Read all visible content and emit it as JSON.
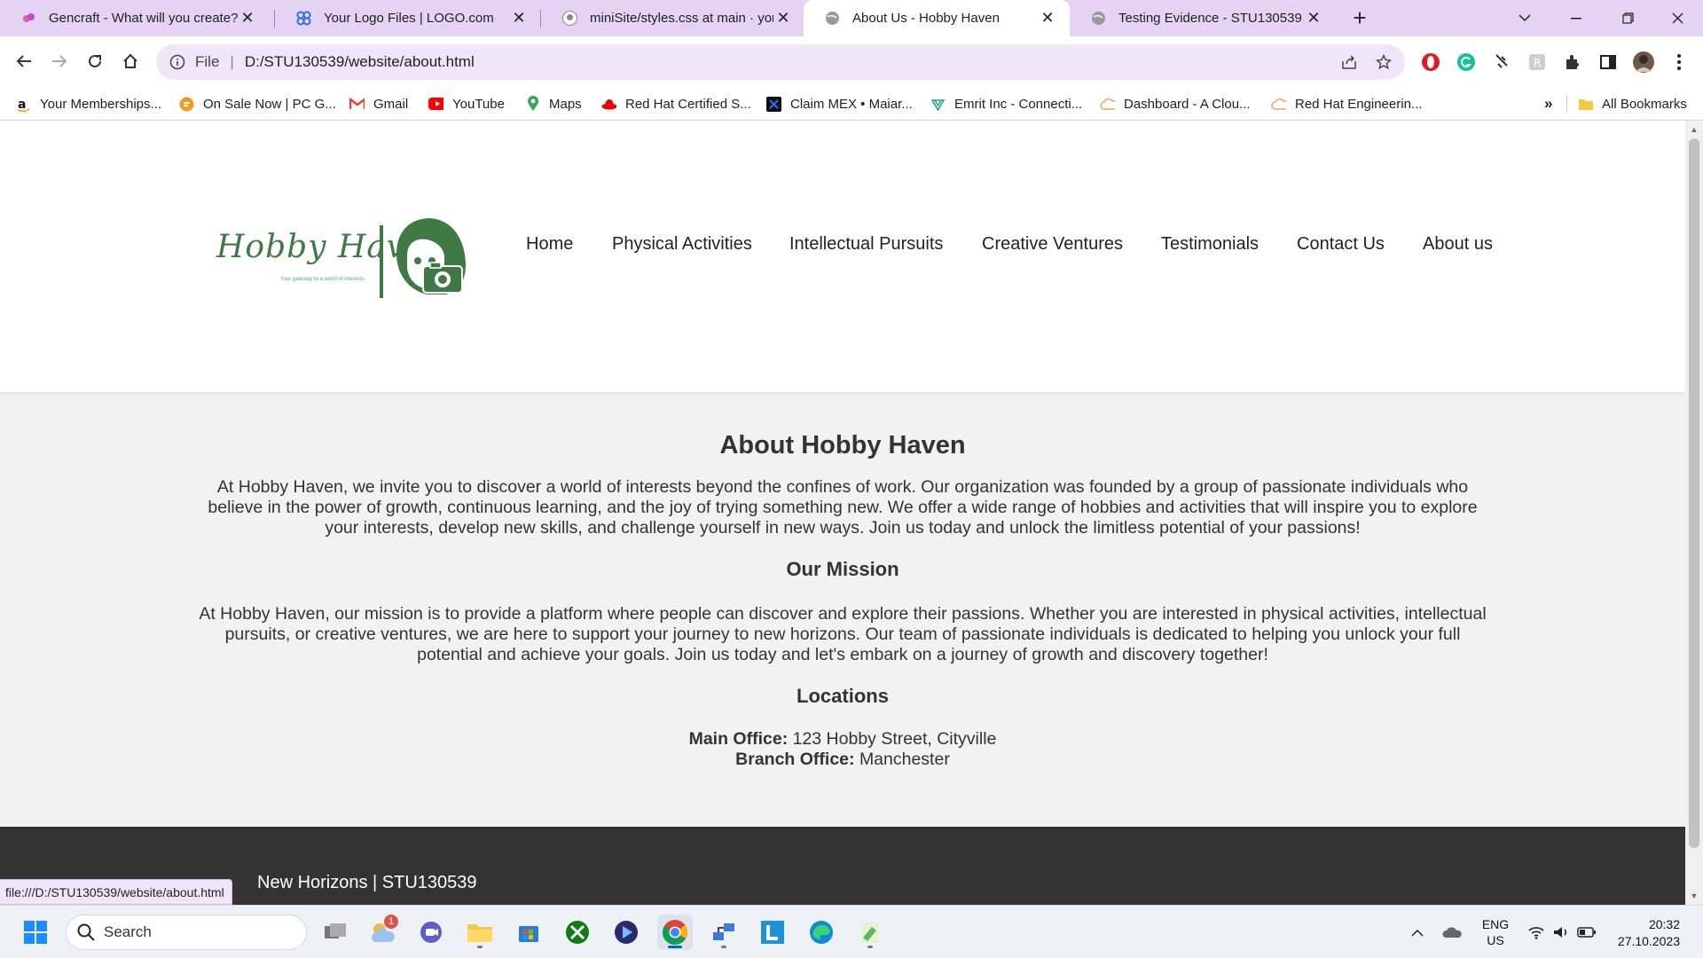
{
  "browser": {
    "tabs": [
      {
        "title": "Gencraft - What will you create?",
        "icon": "gencraft-icon",
        "active": false
      },
      {
        "title": "Your Logo Files | LOGO.com",
        "icon": "logo-com-icon",
        "active": false
      },
      {
        "title": "miniSite/styles.css at main · yom",
        "icon": "github-icon",
        "active": false
      },
      {
        "title": "About Us - Hobby Haven",
        "icon": "globe-icon",
        "active": true
      },
      {
        "title": "Testing Evidence - STU130539",
        "icon": "globe-icon",
        "active": false
      }
    ],
    "address": {
      "scheme": "File",
      "url": "D:/STU130539/website/about.html"
    },
    "bookmarks": [
      {
        "label": "Your Memberships...",
        "icon": "amazon-icon"
      },
      {
        "label": "On Sale Now | PC G...",
        "icon": "pcgamer-icon"
      },
      {
        "label": "Gmail",
        "icon": "gmail-icon"
      },
      {
        "label": "YouTube",
        "icon": "youtube-icon"
      },
      {
        "label": "Maps",
        "icon": "maps-icon"
      },
      {
        "label": "Red Hat Certified S...",
        "icon": "redhat-icon"
      },
      {
        "label": "Claim MEX • Maiar...",
        "icon": "maiar-icon"
      },
      {
        "label": "Emrit Inc - Connecti...",
        "icon": "emrit-icon"
      },
      {
        "label": "Dashboard - A Clou...",
        "icon": "cloud-icon"
      },
      {
        "label": "Red Hat Engineerin...",
        "icon": "cloud-icon"
      }
    ],
    "bookmarks_overflow": "»",
    "all_bookmarks": "All Bookmarks",
    "status_url": "file:///D:/STU130539/website/about.html"
  },
  "site": {
    "logo": {
      "name": "Hobby Haven",
      "tagline": "Your gateway to a world of interests"
    },
    "nav": [
      "Home",
      "Physical Activities",
      "Intellectual Pursuits",
      "Creative Ventures",
      "Testimonials",
      "Contact Us",
      "About us"
    ],
    "about": {
      "heading": "About Hobby Haven",
      "lines": [
        "At Hobby Haven, we invite you to discover a world of interests beyond the confines of work. Our organization was founded by a group of passionate individuals who",
        "believe in the power of growth, continuous learning, and the joy of trying something new. We offer a wide range of hobbies and activities that will inspire you to explore",
        "your interests, develop new skills, and challenge yourself in new ways. Join us today and unlock the limitless potential of your passions!"
      ]
    },
    "mission": {
      "heading": "Our Mission",
      "lines": [
        "At Hobby Haven, our mission is to provide a platform where people can discover and explore their passions. Whether you are interested in physical activities, intellectual",
        "pursuits, or creative ventures, we are here to support your journey to new horizons. Our team of passionate individuals is dedicated to helping you unlock your full",
        "potential and achieve your goals. Join us today and let's embark on a journey of growth and discovery together!"
      ]
    },
    "locations": {
      "heading": "Locations",
      "main_label": "Main Office:",
      "main_value": "123 Hobby Street, Cityville",
      "branch_label": "Branch Office:",
      "branch_value": "Manchester"
    },
    "footer_text": "New Horizons | STU130539"
  },
  "taskbar": {
    "search_label": "Search",
    "weather_badge": "1",
    "language": "ENG",
    "region": "US",
    "time": "20:32",
    "date": "27.10.2023"
  },
  "colors": {
    "brand_green": "#3f7a45",
    "footer_bg": "#333333",
    "tab_strip": "#e5d3f3"
  }
}
